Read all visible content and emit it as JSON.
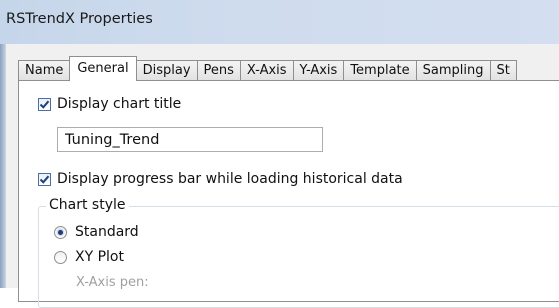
{
  "window": {
    "title": "RSTrendX Properties"
  },
  "tabs": [
    {
      "label": "Name",
      "active": false
    },
    {
      "label": "General",
      "active": true
    },
    {
      "label": "Display",
      "active": false
    },
    {
      "label": "Pens",
      "active": false
    },
    {
      "label": "X-Axis",
      "active": false
    },
    {
      "label": "Y-Axis",
      "active": false
    },
    {
      "label": "Template",
      "active": false
    },
    {
      "label": "Sampling",
      "active": false
    },
    {
      "label": "St",
      "active": false
    }
  ],
  "general": {
    "display_title": {
      "label": "Display chart title",
      "checked": true
    },
    "title_value": "Tuning_Trend",
    "progress_bar": {
      "label": "Display progress bar while loading historical data",
      "checked": true
    },
    "chart_style": {
      "label": "Chart style",
      "options": [
        {
          "label": "Standard",
          "selected": true
        },
        {
          "label": "XY Plot",
          "selected": false
        }
      ],
      "xaxis_pen_label": "X-Axis pen:"
    }
  },
  "colors": {
    "titlebar": "#cfdcee",
    "tab_border": "#8e8f8f",
    "check_accent": "#1e3f78"
  }
}
